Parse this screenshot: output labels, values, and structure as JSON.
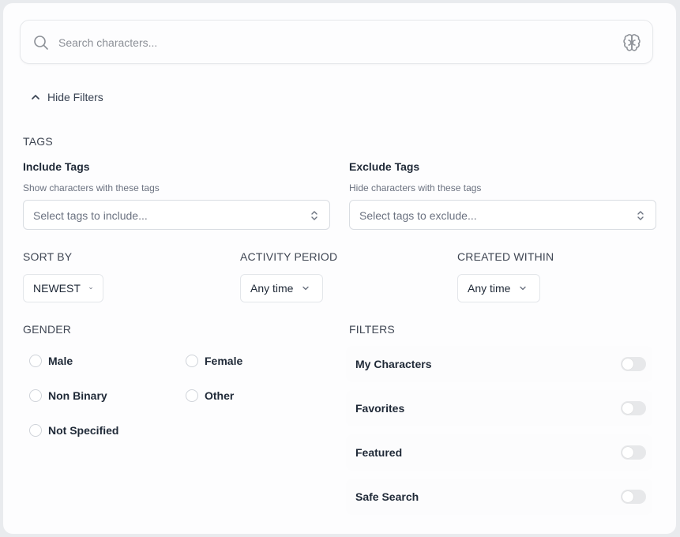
{
  "search": {
    "placeholder": "Search characters..."
  },
  "filters_toggle": {
    "label": "Hide Filters"
  },
  "tags": {
    "title": "TAGS",
    "include": {
      "label": "Include Tags",
      "hint": "Show characters with these tags",
      "placeholder": "Select tags to include..."
    },
    "exclude": {
      "label": "Exclude Tags",
      "hint": "Hide characters with these tags",
      "placeholder": "Select tags to exclude..."
    }
  },
  "sort_by": {
    "title": "SORT BY",
    "value": "NEWEST"
  },
  "activity_period": {
    "title": "ACTIVITY PERIOD",
    "value": "Any time"
  },
  "created_within": {
    "title": "CREATED WITHIN",
    "value": "Any time"
  },
  "gender": {
    "title": "GENDER",
    "options": [
      "Male",
      "Female",
      "Non Binary",
      "Other",
      "Not Specified"
    ]
  },
  "filters": {
    "title": "FILTERS",
    "items": [
      {
        "label": "My Characters",
        "enabled": false
      },
      {
        "label": "Favorites",
        "enabled": false
      },
      {
        "label": "Featured",
        "enabled": false
      },
      {
        "label": "Safe Search",
        "enabled": false
      }
    ]
  }
}
